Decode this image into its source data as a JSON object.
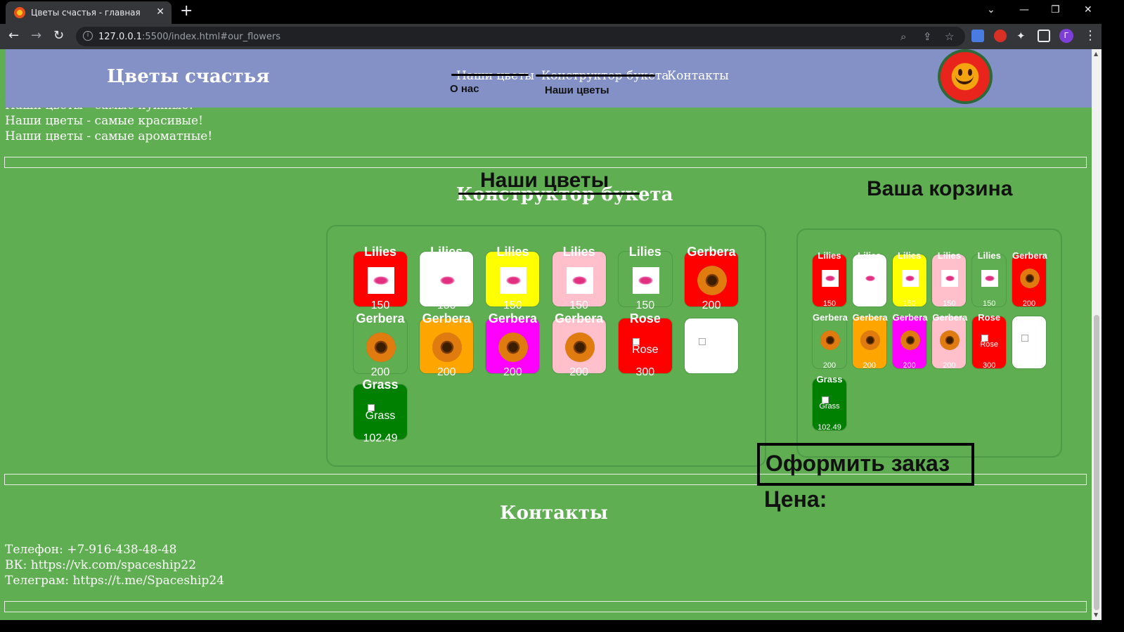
{
  "browser": {
    "tab_title": "Цветы счастья - главная",
    "url_host": "127.0.0.1",
    "url_rest": ":5500/index.html#our_flowers",
    "profile_initial": "Г"
  },
  "header": {
    "site_title": "Цветы счастья",
    "nav_top": [
      "Наши цветы",
      "Конструктор букета",
      "Контакты"
    ],
    "nav_bottom": [
      "О нас",
      "Наши цветы"
    ]
  },
  "slogans": [
    "Наши цветы - самые нужные!",
    "Наши цветы - самые красивые!",
    "Наши цветы - самые ароматные!"
  ],
  "sections": {
    "constructor_title": "Конструктор букета",
    "our_flowers_title": "Наши цветы",
    "cart_title": "Ваша корзина",
    "order_button": "Оформить заказ",
    "price_label": "Цена:",
    "contacts_title": "Контакты"
  },
  "products": [
    {
      "name": "Lilies",
      "price": "150",
      "color": "#ff0000",
      "picture": "lily"
    },
    {
      "name": "Lilies",
      "price": "150",
      "color": "#ffffff",
      "picture": "lily"
    },
    {
      "name": "Lilies",
      "price": "150",
      "color": "#ffff00",
      "picture": "lily"
    },
    {
      "name": "Lilies",
      "price": "150",
      "color": "#ffc0cb",
      "picture": "lily"
    },
    {
      "name": "Lilies",
      "price": "150",
      "color": "#5fae51",
      "picture": "lily"
    },
    {
      "name": "Gerbera",
      "price": "200",
      "color": "#ff0000",
      "picture": "gerbera"
    },
    {
      "name": "Gerbera",
      "price": "200",
      "color": "#5fae51",
      "picture": "gerbera"
    },
    {
      "name": "Gerbera",
      "price": "200",
      "color": "#ffa500",
      "picture": "gerbera"
    },
    {
      "name": "Gerbera",
      "price": "200",
      "color": "#ff00ff",
      "picture": "gerbera"
    },
    {
      "name": "Gerbera",
      "price": "200",
      "color": "#ffc0cb",
      "picture": "gerbera"
    },
    {
      "name": "Rose",
      "price": "300",
      "color": "#ff0000",
      "picture": "broken",
      "alt": "Rose"
    },
    {
      "name": "",
      "price": "",
      "color": "#ffffff",
      "picture": "broken",
      "alt": ""
    },
    {
      "name": "Grass",
      "price": "102.49",
      "color": "#008000",
      "picture": "broken",
      "alt": "Grass"
    }
  ],
  "contacts": [
    "Телефон: +7-916-438-48-48",
    "ВК: https://vk.com/spaceship22",
    "Телеграм: https://t.me/Spaceship24"
  ]
}
